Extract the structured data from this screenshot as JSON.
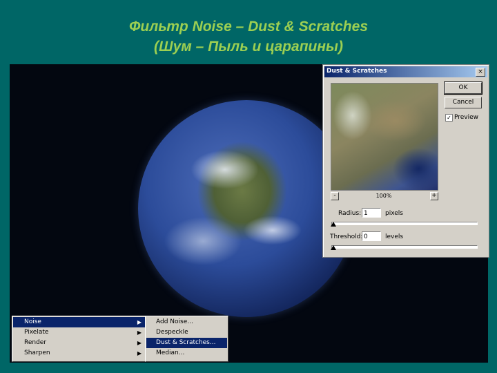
{
  "slide": {
    "title_line1": "Фильтр Noise – Dust & Scratches",
    "title_line2": "(Шум – Пыль и царапины)"
  },
  "dialog": {
    "title": "Dust & Scratches",
    "close_glyph": "×",
    "ok_label": "OK",
    "cancel_label": "Cancel",
    "preview_label": "Preview",
    "preview_checked": true,
    "check_glyph": "✓",
    "zoom_minus": "-",
    "zoom_plus": "+",
    "zoom_level": "100%",
    "radius": {
      "label": "Radius:",
      "value": "1",
      "unit": "pixels"
    },
    "threshold": {
      "label": "Threshold:",
      "value": "0",
      "unit": "levels"
    }
  },
  "menu": {
    "items": [
      {
        "label": "Noise",
        "selected": true
      },
      {
        "label": "Pixelate",
        "selected": false
      },
      {
        "label": "Render",
        "selected": false
      },
      {
        "label": "Sharpen",
        "selected": false
      }
    ],
    "submenu": [
      {
        "label": "Add Noise...",
        "selected": false
      },
      {
        "label": "Despeckle",
        "selected": false
      },
      {
        "label": "Dust & Scratches...",
        "selected": true
      },
      {
        "label": "Median...",
        "selected": false
      }
    ],
    "arrow_glyph": "▶"
  },
  "colors": {
    "background": "#006666",
    "title": "#9ccf52",
    "menu_highlight": "#0a246a",
    "dialog_face": "#d4d0c8"
  }
}
